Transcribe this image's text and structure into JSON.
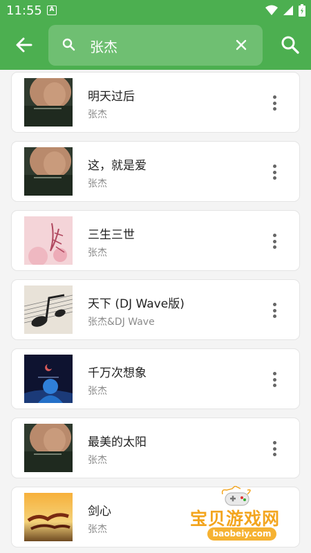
{
  "status_bar": {
    "time": "11:55",
    "notification_glyph": "A"
  },
  "header": {
    "search_query": "张杰",
    "back_icon": "arrow-left-icon",
    "search_icon": "search-icon",
    "clear_icon": "close-icon"
  },
  "songs": [
    {
      "title": "明天过后",
      "artist": "张杰",
      "cover": "portrait"
    },
    {
      "title": "这，就是爱",
      "artist": "张杰",
      "cover": "portrait"
    },
    {
      "title": "三生三世",
      "artist": "张杰",
      "cover": "peach"
    },
    {
      "title": "天下 (DJ Wave版)",
      "artist": "张杰&DJ Wave",
      "cover": "sheet-music"
    },
    {
      "title": "千万次想象",
      "artist": "张杰",
      "cover": "night-blue"
    },
    {
      "title": "最美的太阳",
      "artist": "张杰",
      "cover": "portrait"
    },
    {
      "title": "剑心",
      "artist": "张杰",
      "cover": "sunset-calligraphy"
    }
  ],
  "watermark": {
    "text": "宝贝游戏网",
    "url": "baobeiy.com"
  },
  "colors": {
    "primary": "#4caf50",
    "search_box": "#6fbf72",
    "background": "#f4f4f4",
    "watermark": "#f3a51e"
  }
}
